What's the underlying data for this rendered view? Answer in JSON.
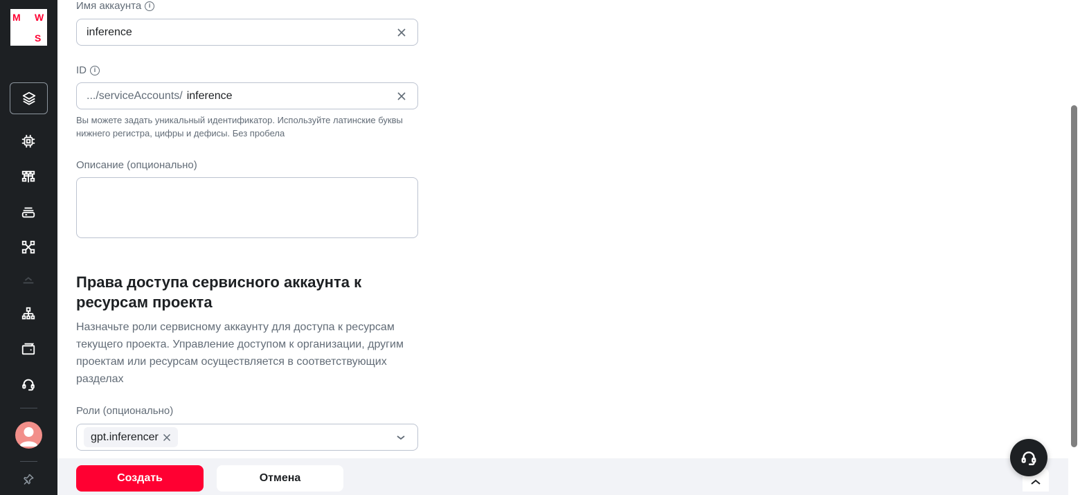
{
  "logo": {
    "letters": [
      "M",
      "W",
      "S"
    ],
    "brand_color": "#ff0032"
  },
  "sidebar": {
    "icons": [
      "layers-icon",
      "chip-icon",
      "network-icon",
      "server-icon",
      "kubernetes-icon",
      "org-structure-icon",
      "wallet-icon",
      "support-icon",
      "pin-icon"
    ],
    "active": "layers-icon"
  },
  "form": {
    "account_name": {
      "label": "Имя аккаунта",
      "value": "inference"
    },
    "id": {
      "label": "ID",
      "prefix": ".../serviceAccounts/",
      "value": "inference",
      "hint": "Вы можете задать уникальный идентификатор. Используйте латинские буквы нижнего регистра, цифры и дефисы. Без пробела"
    },
    "description": {
      "label": "Описание (опционально)",
      "value": ""
    }
  },
  "access": {
    "title": "Права доступа сервисного аккаунта к ресурсам проекта",
    "description": "Назначьте роли сервисному аккаунту для доступа к ресурсам текущего проекта. Управление доступом к организации, другим проектам или ресурсам осуществляется в соответствующих разделах",
    "roles": {
      "label": "Роли (опционально)",
      "selected": [
        "gpt.inferencer"
      ]
    }
  },
  "footer": {
    "create_label": "Создать",
    "cancel_label": "Отмена"
  },
  "colors": {
    "primary": "#ff0032",
    "sidebar_bg": "#1d2023",
    "text_secondary": "#626c77",
    "border": "#bcc3d0"
  }
}
